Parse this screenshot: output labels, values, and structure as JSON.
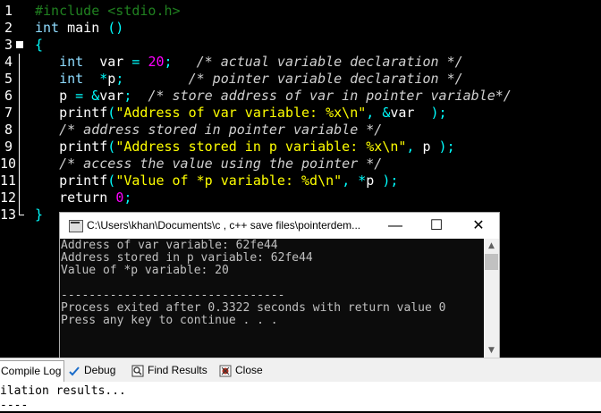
{
  "editor": {
    "line_numbers": [
      "1",
      "2",
      "3",
      "4",
      "5",
      "6",
      "7",
      "8",
      "9",
      "10",
      "11",
      "12",
      "13"
    ],
    "lines": [
      [
        {
          "t": "#include <stdio.h>",
          "c": "preproc"
        }
      ],
      [
        {
          "t": "int",
          "c": "type"
        },
        {
          "t": " main ",
          "c": "plain"
        },
        {
          "t": "()",
          "c": "sym"
        }
      ],
      [
        {
          "t": "{",
          "c": "sym"
        }
      ],
      [
        {
          "t": "   int",
          "c": "type"
        },
        {
          "t": "  var ",
          "c": "plain"
        },
        {
          "t": "=",
          "c": "sym"
        },
        {
          "t": " ",
          "c": "plain"
        },
        {
          "t": "20",
          "c": "num"
        },
        {
          "t": ";",
          "c": "sym"
        },
        {
          "t": "   ",
          "c": "plain"
        },
        {
          "t": "/* actual variable declaration */",
          "c": "cmt"
        }
      ],
      [
        {
          "t": "   int",
          "c": "type"
        },
        {
          "t": "  ",
          "c": "plain"
        },
        {
          "t": "*",
          "c": "sym"
        },
        {
          "t": "p",
          "c": "plain"
        },
        {
          "t": ";",
          "c": "sym"
        },
        {
          "t": "        ",
          "c": "plain"
        },
        {
          "t": "/* pointer variable declaration */",
          "c": "cmt"
        }
      ],
      [
        {
          "t": "   p ",
          "c": "plain"
        },
        {
          "t": "=",
          "c": "sym"
        },
        {
          "t": " ",
          "c": "plain"
        },
        {
          "t": "&",
          "c": "sym"
        },
        {
          "t": "var",
          "c": "plain"
        },
        {
          "t": ";",
          "c": "sym"
        },
        {
          "t": "  ",
          "c": "plain"
        },
        {
          "t": "/* store address of var in pointer variable*/",
          "c": "cmt"
        }
      ],
      [
        {
          "t": "   printf",
          "c": "plain"
        },
        {
          "t": "(",
          "c": "sym"
        },
        {
          "t": "\"Address of var variable: %x\\n\"",
          "c": "str"
        },
        {
          "t": ",",
          "c": "sym"
        },
        {
          "t": " ",
          "c": "plain"
        },
        {
          "t": "&",
          "c": "sym"
        },
        {
          "t": "var  ",
          "c": "plain"
        },
        {
          "t": ");",
          "c": "sym"
        }
      ],
      [
        {
          "t": "   ",
          "c": "plain"
        },
        {
          "t": "/* address stored in pointer variable */",
          "c": "cmt"
        }
      ],
      [
        {
          "t": "   printf",
          "c": "plain"
        },
        {
          "t": "(",
          "c": "sym"
        },
        {
          "t": "\"Address stored in p variable: %x\\n\"",
          "c": "str"
        },
        {
          "t": ",",
          "c": "sym"
        },
        {
          "t": " p ",
          "c": "plain"
        },
        {
          "t": ");",
          "c": "sym"
        }
      ],
      [
        {
          "t": "   ",
          "c": "plain"
        },
        {
          "t": "/* access the value using the pointer */",
          "c": "cmt"
        }
      ],
      [
        {
          "t": "   printf",
          "c": "plain"
        },
        {
          "t": "(",
          "c": "sym"
        },
        {
          "t": "\"Value of *p variable: %d\\n\"",
          "c": "str"
        },
        {
          "t": ",",
          "c": "sym"
        },
        {
          "t": " ",
          "c": "plain"
        },
        {
          "t": "*",
          "c": "sym"
        },
        {
          "t": "p ",
          "c": "plain"
        },
        {
          "t": ");",
          "c": "sym"
        }
      ],
      [
        {
          "t": "   return",
          "c": "kw"
        },
        {
          "t": " ",
          "c": "plain"
        },
        {
          "t": "0",
          "c": "num"
        },
        {
          "t": ";",
          "c": "sym"
        }
      ],
      [
        {
          "t": "}",
          "c": "sym"
        }
      ]
    ]
  },
  "console": {
    "title": "C:\\Users\\khan\\Documents\\c , c++ save files\\pointerdem...",
    "minimize": "—",
    "maximize": "☐",
    "close": "✕",
    "output_lines": [
      "Address of var variable: 62fe44",
      "Address stored in p variable: 62fe44",
      "Value of *p variable: 20",
      "",
      "--------------------------------",
      "Process exited after 0.3322 seconds with return value 0",
      "Press any key to continue . . ."
    ],
    "scroll_up": "▲",
    "scroll_down": "▼"
  },
  "tabs": [
    {
      "label": "Compile Log",
      "icon": "compile-log-icon",
      "active": true
    },
    {
      "label": "Debug",
      "icon": "debug-check-icon",
      "active": false
    },
    {
      "label": "Find Results",
      "icon": "find-results-icon",
      "active": false
    },
    {
      "label": "Close",
      "icon": "close-bug-icon",
      "active": false
    }
  ],
  "log_lines": [
    "ilation results...",
    "----"
  ]
}
